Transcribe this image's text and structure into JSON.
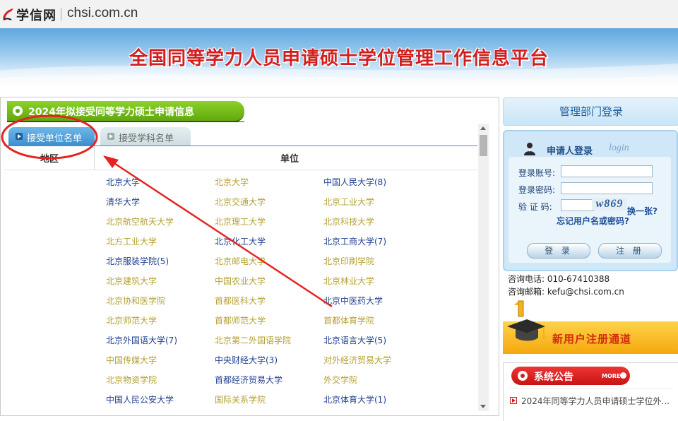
{
  "brand": {
    "logo_text": "学信网",
    "domain": "chsi.com.cn"
  },
  "banner": {
    "title": "全国同等学力人员申请硕士学位管理工作信息平台"
  },
  "section": {
    "title": "2024年拟接受同等学力硕士申请信息"
  },
  "tabs": [
    {
      "label": "接受单位名单",
      "active": true
    },
    {
      "label": "接受学科名单",
      "active": false
    }
  ],
  "table": {
    "headers": [
      "地区",
      "单位"
    ],
    "rows": [
      [
        {
          "text": "北京大学",
          "color": "navy"
        },
        {
          "text": "北京大学",
          "color": "gold"
        },
        {
          "text": "中国人民大学(8)",
          "color": "navy"
        }
      ],
      [
        {
          "text": "清华大学",
          "color": "navy"
        },
        {
          "text": "北京交通大学",
          "color": "gold"
        },
        {
          "text": "北京工业大学",
          "color": "gold"
        }
      ],
      [
        {
          "text": "北京航空航天大学",
          "color": "gold"
        },
        {
          "text": "北京理工大学",
          "color": "gold"
        },
        {
          "text": "北京科技大学",
          "color": "gold"
        }
      ],
      [
        {
          "text": "北方工业大学",
          "color": "gold"
        },
        {
          "text": "北京化工大学",
          "color": "navy"
        },
        {
          "text": "北京工商大学(7)",
          "color": "navy"
        }
      ],
      [
        {
          "text": "北京服装学院(5)",
          "color": "navy"
        },
        {
          "text": "北京邮电大学",
          "color": "gold"
        },
        {
          "text": "北京印刷学院",
          "color": "gold"
        }
      ],
      [
        {
          "text": "北京建筑大学",
          "color": "gold"
        },
        {
          "text": "中国农业大学",
          "color": "gold"
        },
        {
          "text": "北京林业大学",
          "color": "gold"
        }
      ],
      [
        {
          "text": "北京协和医学院",
          "color": "gold"
        },
        {
          "text": "首都医科大学",
          "color": "gold"
        },
        {
          "text": "北京中医药大学",
          "color": "navy"
        }
      ],
      [
        {
          "text": "北京师范大学",
          "color": "gold"
        },
        {
          "text": "首都师范大学",
          "color": "gold"
        },
        {
          "text": "首都体育学院",
          "color": "gold"
        }
      ],
      [
        {
          "text": "北京外国语大学(7)",
          "color": "navy"
        },
        {
          "text": "北京第二外国语学院",
          "color": "gold"
        },
        {
          "text": "北京语言大学(5)",
          "color": "navy"
        }
      ],
      [
        {
          "text": "中国传媒大学",
          "color": "gold"
        },
        {
          "text": "中央财经大学(3)",
          "color": "navy"
        },
        {
          "text": "对外经济贸易大学",
          "color": "gold"
        }
      ],
      [
        {
          "text": "北京物资学院",
          "color": "gold"
        },
        {
          "text": "首都经济贸易大学",
          "color": "navy"
        },
        {
          "text": "外交学院",
          "color": "gold"
        }
      ],
      [
        {
          "text": "中国人民公安大学",
          "color": "navy"
        },
        {
          "text": "国际关系学院",
          "color": "gold"
        },
        {
          "text": "北京体育大学(1)",
          "color": "navy"
        }
      ]
    ]
  },
  "right": {
    "mgmt_login": "管理部门登录",
    "login": {
      "title": "申请人登录",
      "subtitle": "login",
      "account_label": "登录账号:",
      "password_label": "登录密码:",
      "captcha_label": "验 证 码:",
      "captcha_image_text": "w869",
      "refresh": "换一张?",
      "forgot": "忘记用户名或密码?",
      "login_button": "登 录",
      "register_button": "注 册"
    },
    "contact_phone": "咨询电话:  010-67410388",
    "contact_email": "咨询邮箱:  kefu@chsi.com.cn",
    "register_banner": "新用户注册通道",
    "notice": {
      "title": "系统公告",
      "more": "MORE",
      "items": [
        "2024年同等学力人员申请硕士学位外..."
      ]
    }
  },
  "colors": {
    "gold_link": "#b5a133",
    "navy_link": "#1f3f8f",
    "annotation_red": "#e52421",
    "section_green": "#62a80e",
    "notice_red": "#c81414"
  }
}
